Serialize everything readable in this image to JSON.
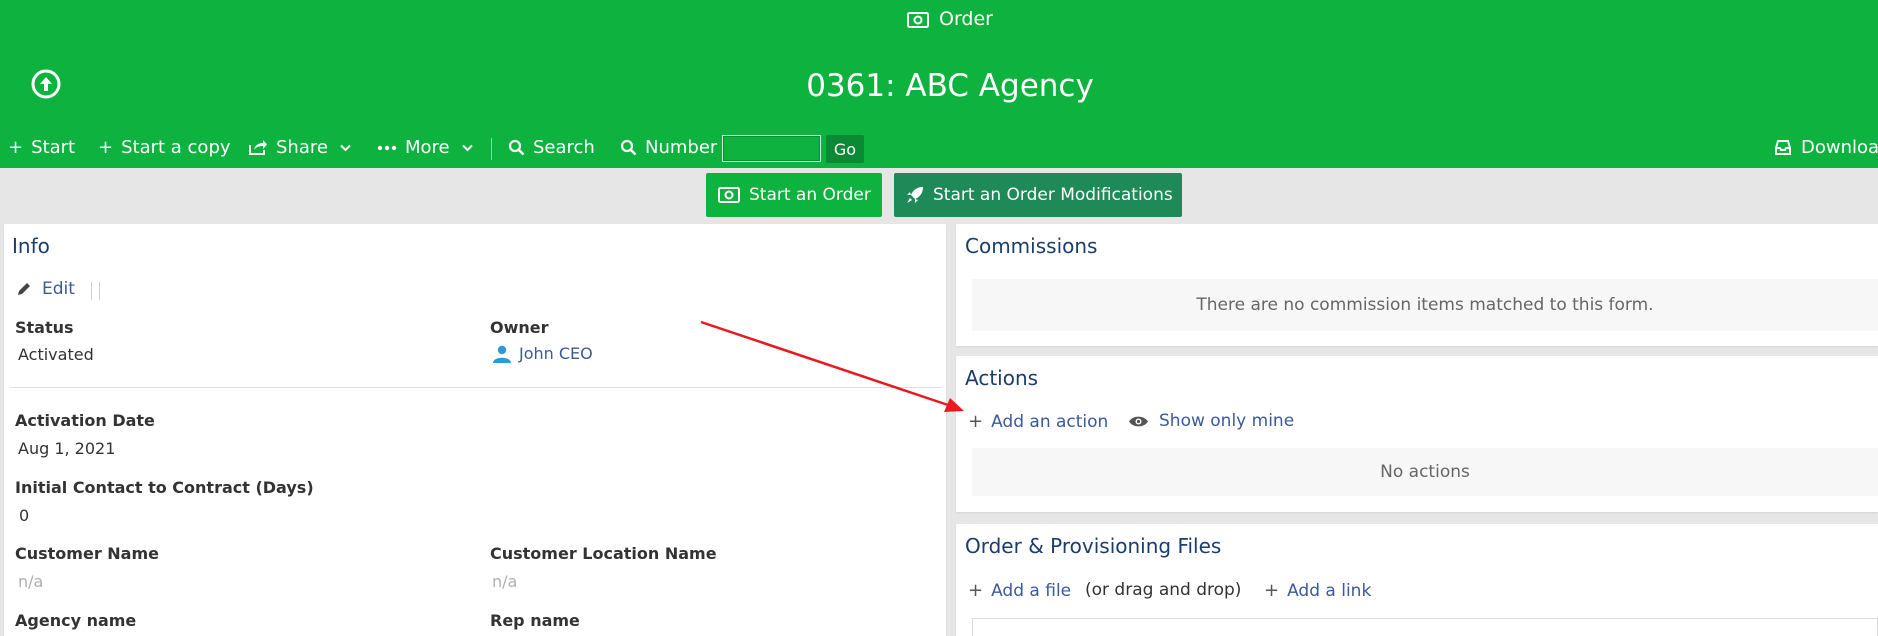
{
  "header": {
    "module": "Order",
    "title": "0361: ABC Agency"
  },
  "toolbar": {
    "start": "Start",
    "start_copy": "Start a copy",
    "share": "Share",
    "more": "More",
    "search": "Search",
    "number": "Number",
    "number_value": "",
    "go": "Go",
    "download": "Download"
  },
  "buttons": {
    "start_order": "Start an Order",
    "start_modification": "Start an Order Modifications"
  },
  "info": {
    "title": "Info",
    "edit": "Edit",
    "status_label": "Status",
    "status_value": "Activated",
    "owner_label": "Owner",
    "owner_value": "John CEO",
    "activation_date_label": "Activation Date",
    "activation_date_value": "Aug 1, 2021",
    "initial_contact_label": "Initial Contact to Contract (Days)",
    "initial_contact_value": "0",
    "customer_name_label": "Customer Name",
    "customer_name_value": "n/a",
    "customer_location_label": "Customer Location Name",
    "customer_location_value": "n/a",
    "agency_name_label": "Agency name",
    "rep_name_label": "Rep name"
  },
  "commissions": {
    "title": "Commissions",
    "empty": "There are no commission items matched to this form."
  },
  "actions": {
    "title": "Actions",
    "add": "Add an action",
    "show_mine": "Show only mine",
    "empty": "No actions"
  },
  "files": {
    "title": "Order & Provisioning Files",
    "add_file": "Add a file",
    "drag_drop": "(or drag and drop)",
    "add_link": "Add a link"
  },
  "colors": {
    "header_green": "#0db23f",
    "modification_button": "#1d8a57",
    "title_blue": "#1a3d6e",
    "annotation_arrow": "#e8191f"
  }
}
